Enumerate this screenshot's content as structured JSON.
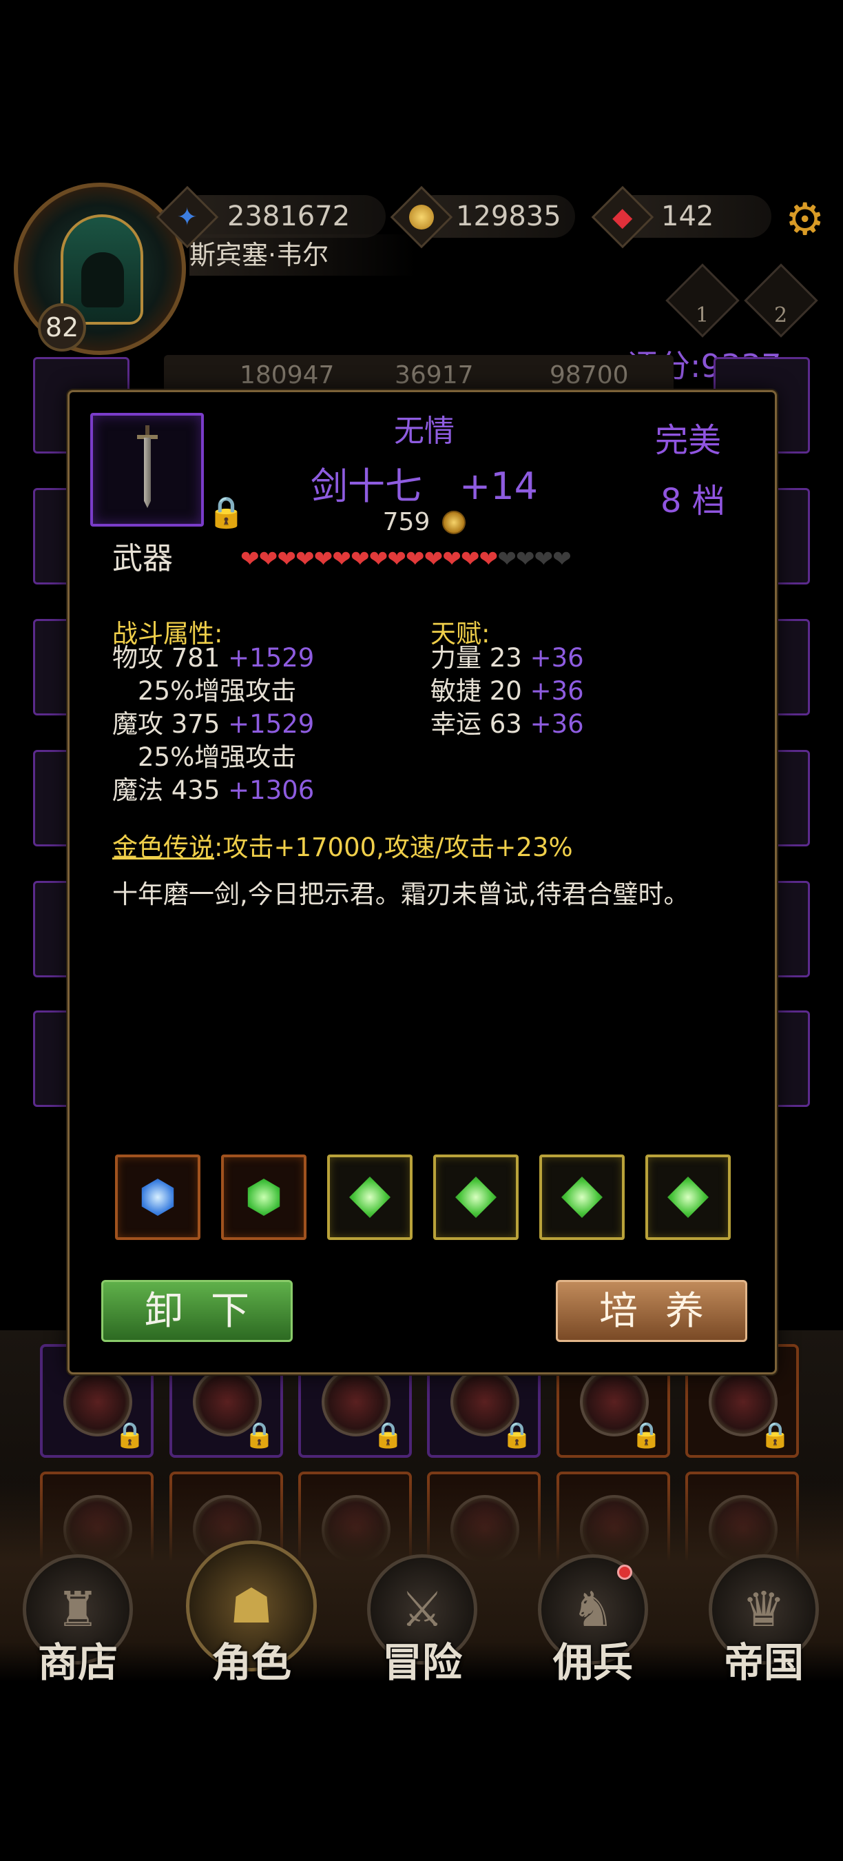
{
  "player": {
    "name": "斯宾塞·韦尔",
    "level": "82",
    "score": "评分:9337"
  },
  "resources": [
    {
      "icon": "blue-crystal-icon",
      "value": "2381672"
    },
    {
      "icon": "gold-coin-icon",
      "value": "129835"
    },
    {
      "icon": "red-gem-icon",
      "value": "142"
    }
  ],
  "ranks": [
    {
      "icon": "rank-one-icon",
      "label": "1"
    },
    {
      "icon": "rank-two-icon",
      "label": "2"
    }
  ],
  "background_stats": [
    "180947",
    "36917",
    "98700"
  ],
  "item": {
    "prefix": "无情",
    "name": "剑十七　+14",
    "price": "759",
    "quality": "完美",
    "grade": "8 档",
    "slot_label": "武器",
    "hearts_filled": 14,
    "hearts_total": 18,
    "combat_title": "战斗属性:",
    "combat_stats": [
      {
        "base": "物攻 781 ",
        "bonus": "+1529"
      },
      {
        "base": "　25%增强攻击",
        "bonus": ""
      },
      {
        "base": "魔攻 375 ",
        "bonus": "+1529"
      },
      {
        "base": "　25%增强攻击",
        "bonus": ""
      },
      {
        "base": "魔法 435 ",
        "bonus": "+1306"
      }
    ],
    "talent_title": "天赋:",
    "talent_stats": [
      {
        "base": "力量 23 ",
        "bonus": "+36"
      },
      {
        "base": "敏捷 20 ",
        "bonus": "+36"
      },
      {
        "base": "幸运 63 ",
        "bonus": "+36"
      }
    ],
    "legend_label": "金色传说",
    "legend_text": ":攻击+17000,攻速/攻击+23%",
    "flavor": "十年磨一剑,今日把示君。霜刃未曾试,待君合璧时。",
    "gems": [
      {
        "icon": "blue-gem-icon",
        "frame": "orange"
      },
      {
        "icon": "green-hex-gem-icon",
        "frame": "orange"
      },
      {
        "icon": "green-diamond-gem-icon",
        "frame": "gold"
      },
      {
        "icon": "green-diamond-gem-icon",
        "frame": "gold"
      },
      {
        "icon": "green-diamond-gem-icon",
        "frame": "gold"
      },
      {
        "icon": "green-diamond-gem-icon",
        "frame": "gold"
      }
    ],
    "buttons": {
      "unequip": "卸下",
      "train": "培养"
    }
  },
  "nav": [
    {
      "label": "商店",
      "icon": "shop-castle-icon"
    },
    {
      "label": "角色",
      "icon": "hooded-character-icon"
    },
    {
      "label": "冒险",
      "icon": "crossed-swords-icon"
    },
    {
      "label": "佣兵",
      "icon": "mercenary-card-icon"
    },
    {
      "label": "帝国",
      "icon": "crown-icon"
    }
  ],
  "colors": {
    "accent_purple": "#8e5ce0",
    "gold_text": "#f0cf4a",
    "heart_red": "#e23a3a",
    "button_green": "#4a9a3a",
    "button_brown": "#a06a3e"
  }
}
